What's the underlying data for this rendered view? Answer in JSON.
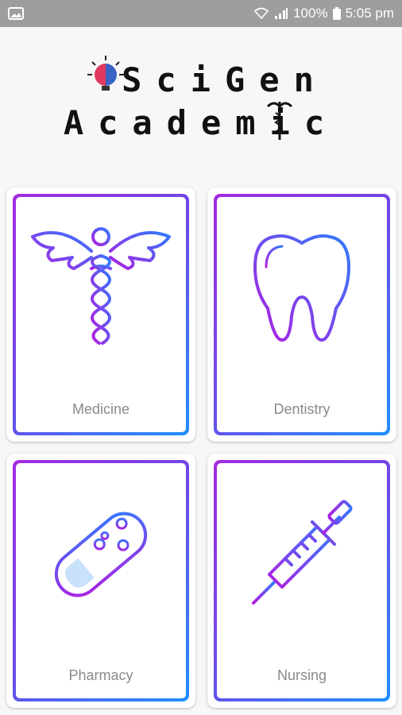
{
  "status_bar": {
    "battery": "100%",
    "time": "5:05 pm",
    "icons": [
      "gallery-icon",
      "wifi-icon",
      "signal-icon",
      "battery-icon"
    ]
  },
  "logo": {
    "line1": "SciGen",
    "line2": "Academic"
  },
  "cards": [
    {
      "label": "Medicine",
      "icon": "caduceus-icon"
    },
    {
      "label": "Dentistry",
      "icon": "tooth-icon"
    },
    {
      "label": "Pharmacy",
      "icon": "capsule-icon"
    },
    {
      "label": "Nursing",
      "icon": "syringe-icon"
    }
  ],
  "colors": {
    "gradient_start": "#a22be0",
    "gradient_end": "#1f8fff",
    "status_bar": "#9e9e9e",
    "label": "#8a8a8a"
  }
}
